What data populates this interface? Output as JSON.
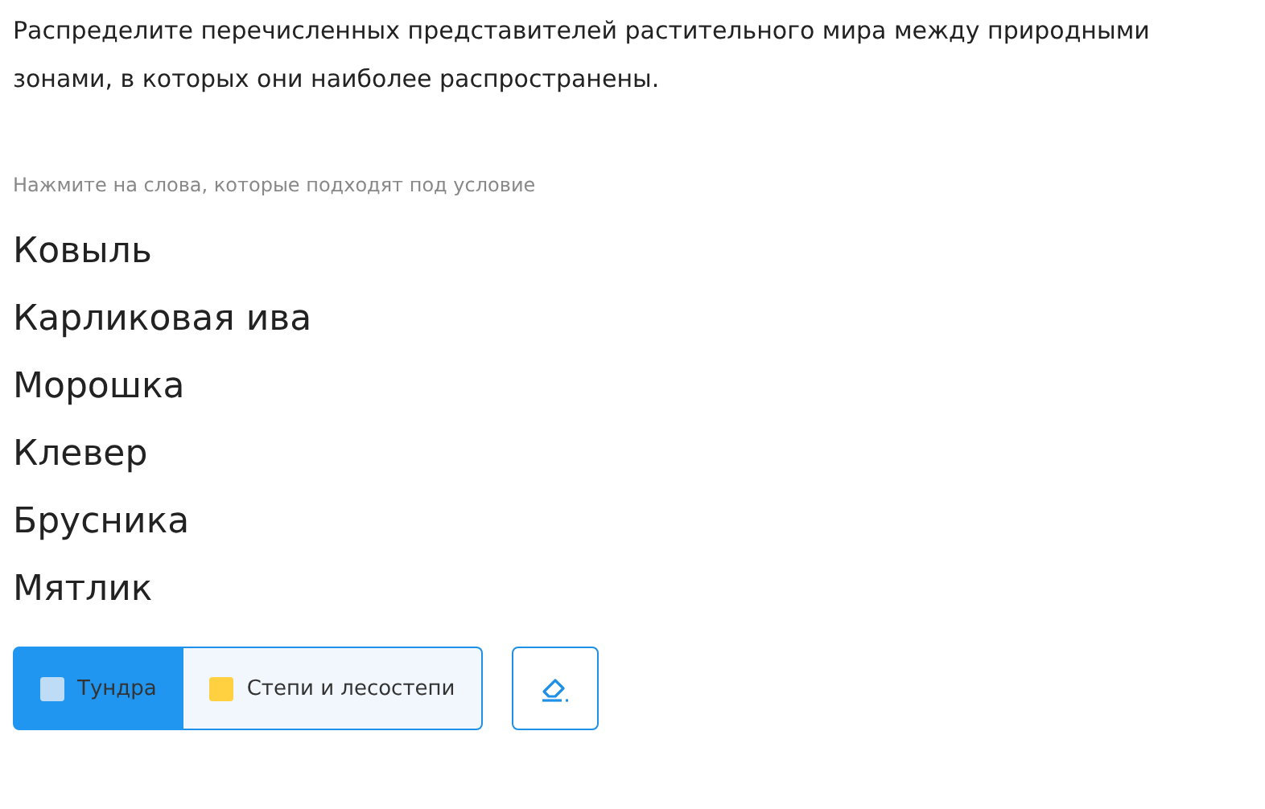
{
  "question": "Распределите перечисленных представителей растительного мира между природными зонами, в которых они наиболее распространены.",
  "hint": "Нажмите на слова, которые подходят под условие",
  "words": [
    "Ковыль",
    "Карликовая ива",
    "Морошка",
    "Клевер",
    "Брусника",
    "Мятлик"
  ],
  "categories": [
    {
      "label": "Тундра",
      "color": "#bfdcf7",
      "selected": true
    },
    {
      "label": "Степи и лесостепи",
      "color": "#ffd03f",
      "selected": false
    }
  ]
}
